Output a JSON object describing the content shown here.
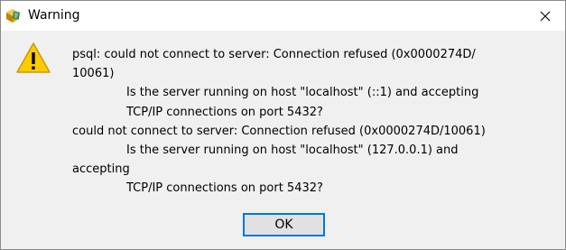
{
  "window": {
    "title": "Warning"
  },
  "message": {
    "lines": [
      "psql: could not connect to server: Connection refused (0x0000274D/",
      "10061)",
      "Is the server running on host \"localhost\" (::1) and accepting",
      "TCP/IP connections on port 5432?",
      "could not connect to server: Connection refused (0x0000274D/10061)",
      "Is the server running on host \"localhost\" (127.0.0.1) and",
      "accepting",
      "TCP/IP connections on port 5432?"
    ]
  },
  "buttons": {
    "ok_label": "OK"
  },
  "icons": {
    "app": "app-icon",
    "warning": "warning-icon",
    "close": "close-icon"
  },
  "colors": {
    "warning_fill": "#FFCC00",
    "focus_border": "#0078D7"
  }
}
